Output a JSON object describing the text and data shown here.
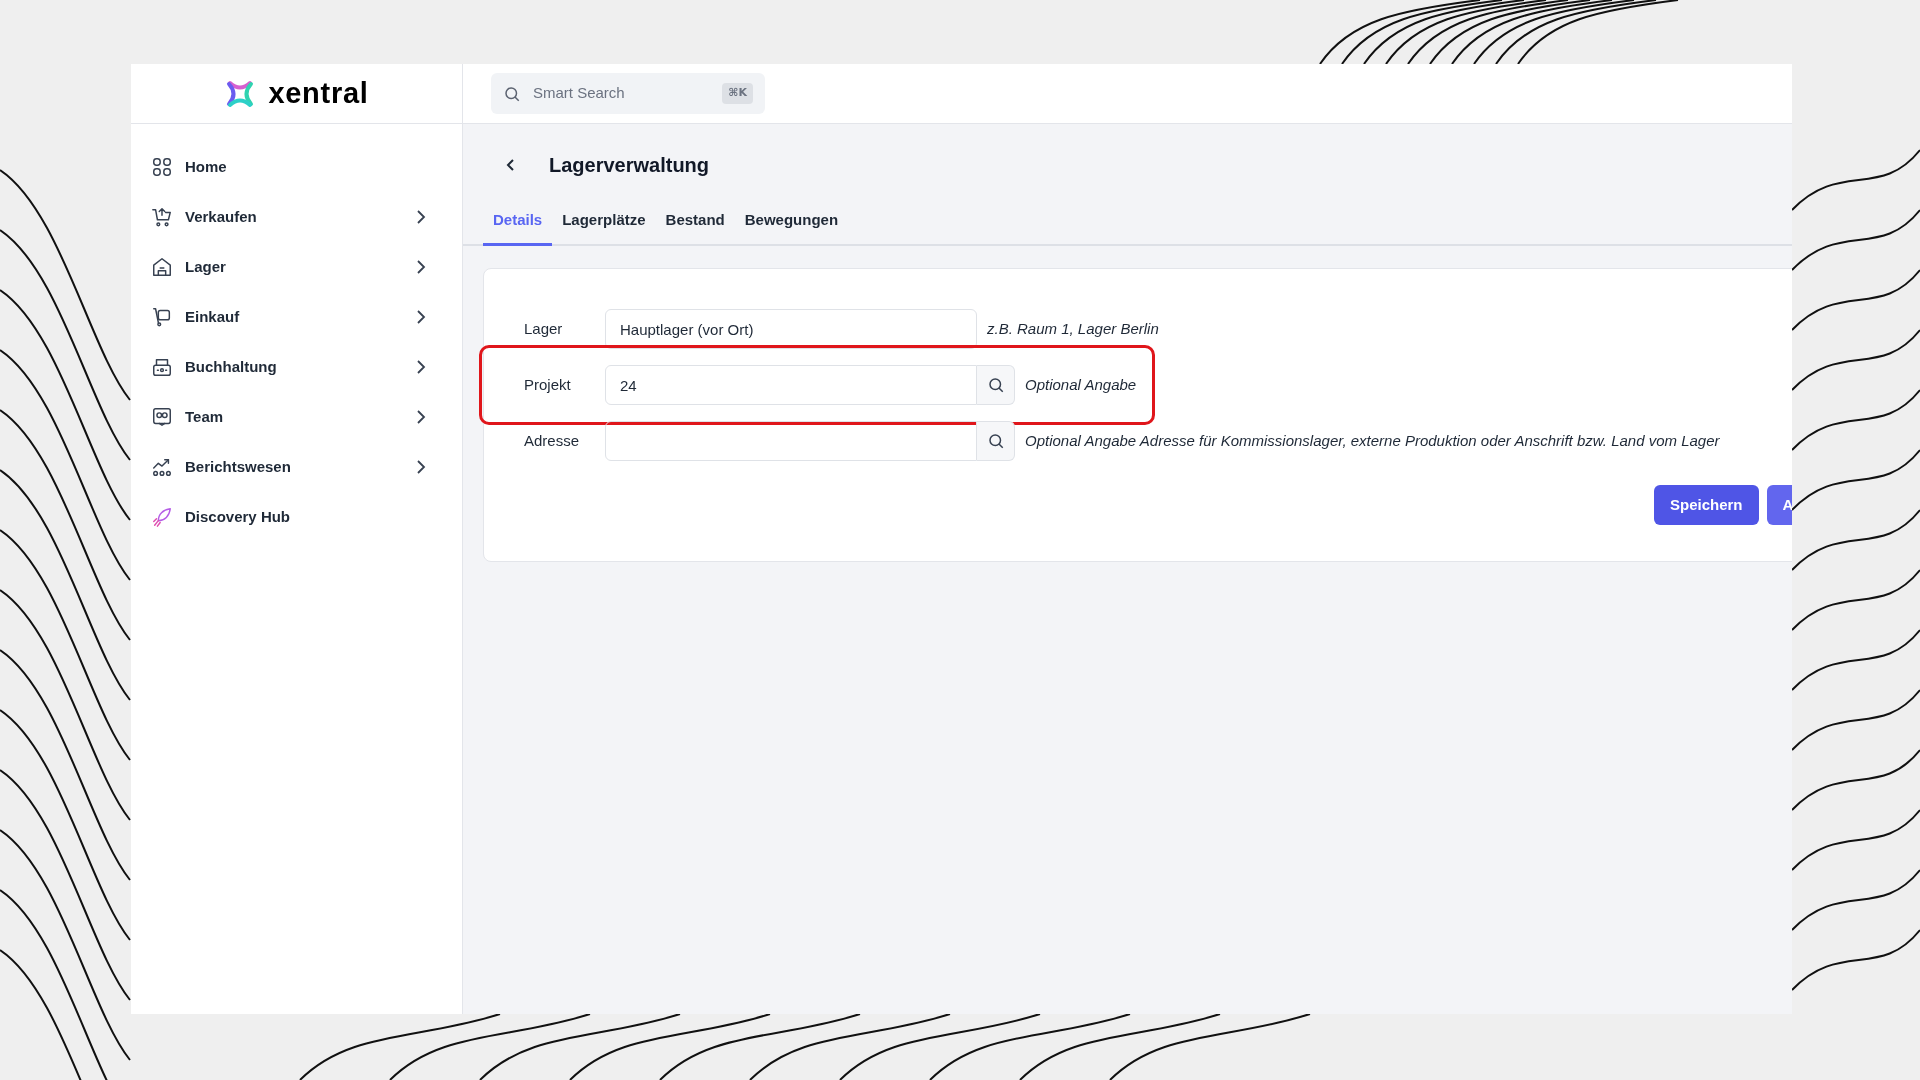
{
  "brand": {
    "name": "xentral"
  },
  "search": {
    "placeholder": "Smart Search",
    "shortcut": "⌘K"
  },
  "sidebar": {
    "items": [
      {
        "label": "Home",
        "expandable": false
      },
      {
        "label": "Verkaufen",
        "expandable": true
      },
      {
        "label": "Lager",
        "expandable": true
      },
      {
        "label": "Einkauf",
        "expandable": true
      },
      {
        "label": "Buchhaltung",
        "expandable": true
      },
      {
        "label": "Team",
        "expandable": true
      },
      {
        "label": "Berichtswesen",
        "expandable": true
      },
      {
        "label": "Discovery Hub",
        "expandable": false
      }
    ]
  },
  "page": {
    "title": "Lagerverwaltung"
  },
  "tabs": [
    {
      "label": "Details",
      "selected": true
    },
    {
      "label": "Lagerplätze",
      "selected": false
    },
    {
      "label": "Bestand",
      "selected": false
    },
    {
      "label": "Bewegungen",
      "selected": false
    }
  ],
  "form": {
    "fields": [
      {
        "label": "Lager",
        "value": "Hauptlager (vor Ort)",
        "lookup": false,
        "hint": "z.B. Raum 1, Lager Berlin",
        "highlighted": false
      },
      {
        "label": "Projekt",
        "value": "24",
        "lookup": true,
        "hint": "Optional Angabe",
        "highlighted": true
      },
      {
        "label": "Adresse",
        "lookup": true,
        "hint": "Optional Angabe Adresse für Kommissionslager, externe Produktion oder Anschrift bzw. Land vom Lager",
        "highlighted": false
      }
    ],
    "buttons": [
      "Speichern",
      "A"
    ]
  }
}
